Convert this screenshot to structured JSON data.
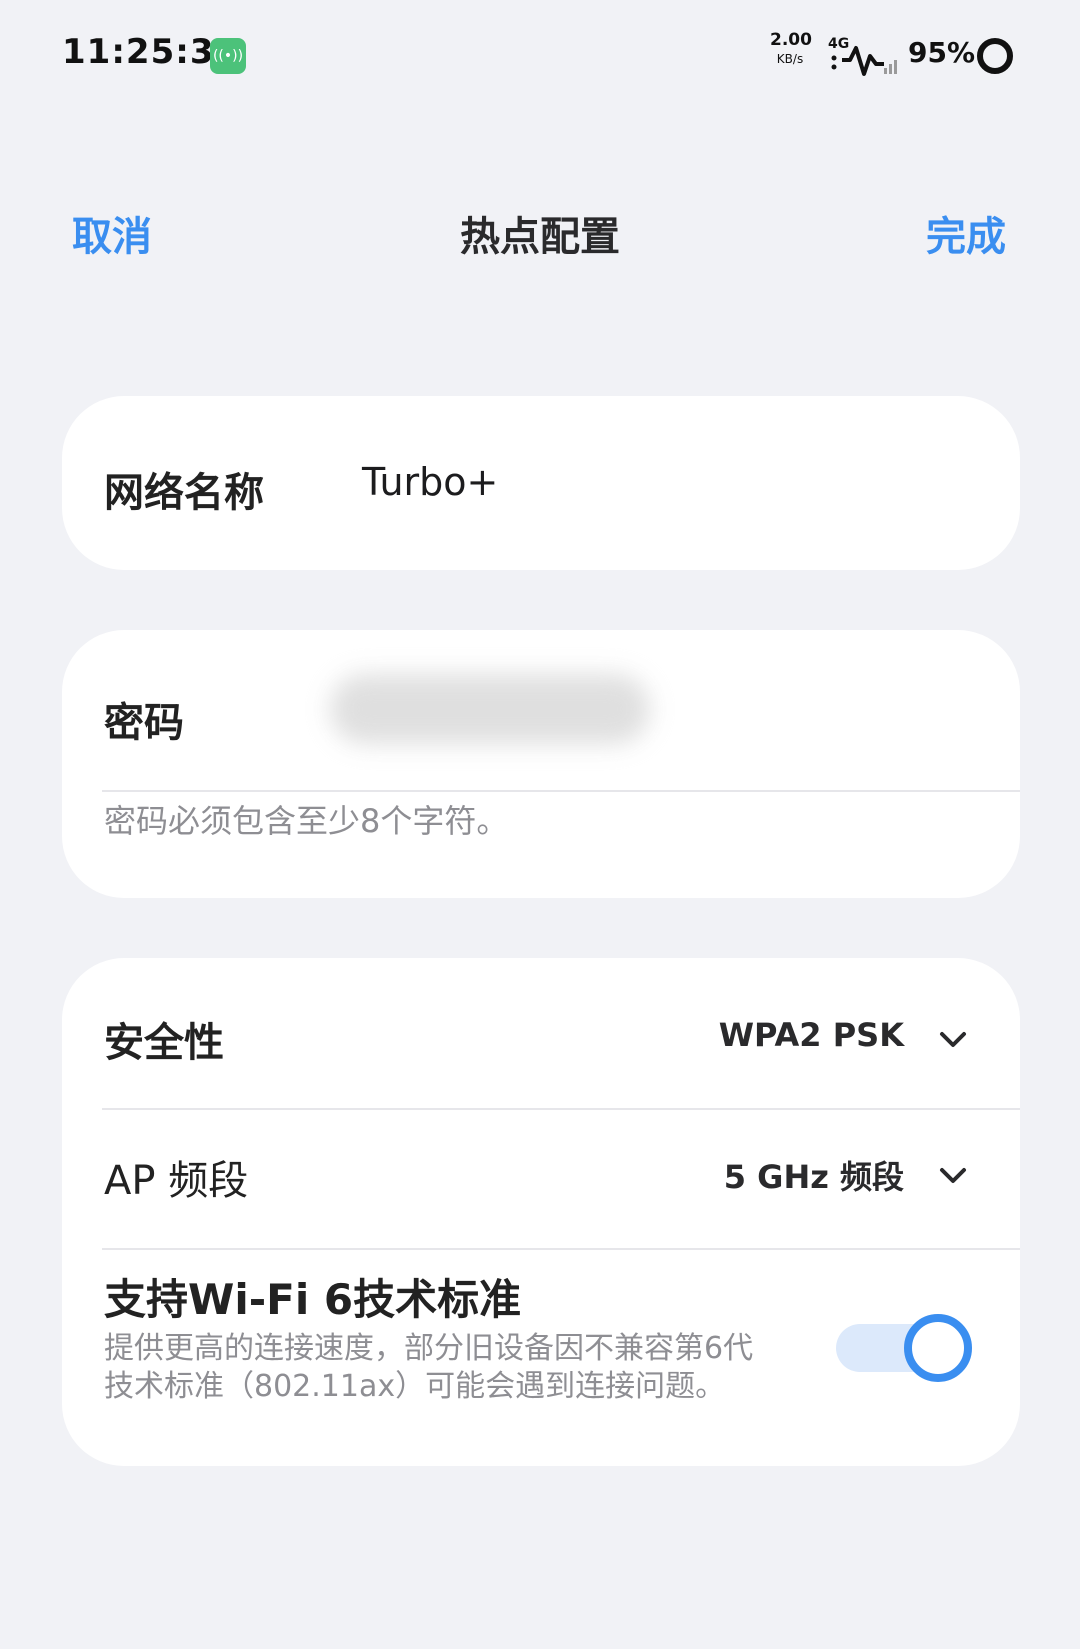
{
  "status_bar": {
    "time": "11:25:30",
    "net_speed_value": "2.00",
    "net_speed_unit": "KB/s",
    "network_type": "4G",
    "battery": "95%",
    "colors": {
      "hotspot_badge": "#4cc27a"
    }
  },
  "header": {
    "cancel_label": "取消",
    "title": "热点配置",
    "done_label": "完成",
    "accent_color": "#3a8ef0"
  },
  "network_name": {
    "label": "网络名称",
    "value": "Turbo+"
  },
  "password": {
    "label": "密码",
    "hint": "密码必须包含至少8个字符。"
  },
  "security": {
    "label": "安全性",
    "value": "WPA2 PSK"
  },
  "ap_band": {
    "label": "AP 频段",
    "value": "5 GHz 频段"
  },
  "wifi6": {
    "title": "支持Wi-Fi 6技术标准",
    "description": "提供更高的连接速度，部分旧设备因不兼容第6代技术标准（802.11ax）可能会遇到连接问题。",
    "enabled": true
  }
}
